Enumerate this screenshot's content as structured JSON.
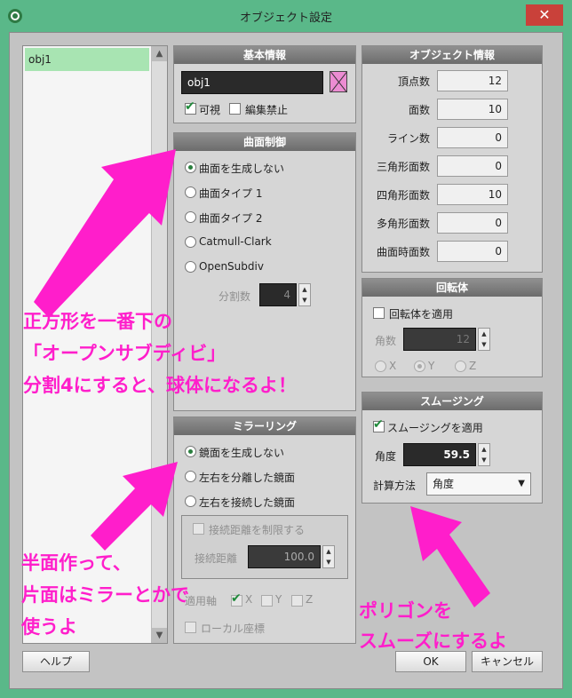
{
  "window": {
    "title": "オブジェクト設定"
  },
  "object_list": {
    "items": [
      "obj1"
    ]
  },
  "basic_info": {
    "header": "基本情報",
    "name_value": "obj1",
    "visible_label": "可視",
    "lock_label": "編集禁止",
    "visible_checked": true,
    "lock_checked": false,
    "color_swatch": "#ec8cd2"
  },
  "object_info": {
    "header": "オブジェクト情報",
    "rows": [
      {
        "label": "頂点数",
        "value": "12"
      },
      {
        "label": "面数",
        "value": "10"
      },
      {
        "label": "ライン数",
        "value": "0"
      },
      {
        "label": "三角形面数",
        "value": "0"
      },
      {
        "label": "四角形面数",
        "value": "10"
      },
      {
        "label": "多角形面数",
        "value": "0"
      },
      {
        "label": "曲面時面数",
        "value": "0"
      }
    ]
  },
  "surface_control": {
    "header": "曲面制御",
    "options": [
      "曲面を生成しない",
      "曲面タイプ 1",
      "曲面タイプ 2",
      "Catmull-Clark",
      "OpenSubdiv"
    ],
    "selected": 0,
    "subdiv_label": "分割数",
    "subdiv_value": "4"
  },
  "revolve": {
    "header": "回転体",
    "apply_label": "回転体を適用",
    "angle_label": "角数",
    "angle_value": "12",
    "axes": [
      "X",
      "Y",
      "Z"
    ],
    "selected_axis": 1
  },
  "smoothing": {
    "header": "スムージング",
    "apply_label": "スムージングを適用",
    "apply_checked": true,
    "angle_label": "角度",
    "angle_value": "59.5",
    "method_label": "計算方法",
    "method_value": "角度"
  },
  "mirroring": {
    "header": "ミラーリング",
    "options": [
      "鏡面を生成しない",
      "左右を分離した鏡面",
      "左右を接続した鏡面"
    ],
    "selected": 0,
    "limit_label": "接続距離を制限する",
    "distance_label": "接続距離",
    "distance_value": "100.0",
    "axis_label": "適用軸",
    "axes": [
      "X",
      "Y",
      "Z"
    ],
    "local_label": "ローカル座標"
  },
  "buttons": {
    "help": "ヘルプ",
    "ok": "OK",
    "cancel": "キャンセル"
  },
  "annotations": {
    "note1_lines": [
      "正方形を一番下の",
      "「オープンサブディビ」",
      "分割4にすると、球体になるよ！"
    ],
    "note2_lines": [
      "半面作って、",
      "片面はミラーとかで",
      "使うよ"
    ],
    "note3_lines": [
      "ポリゴンを",
      "スムーズにするよ"
    ],
    "color": "#ff1ecb"
  }
}
